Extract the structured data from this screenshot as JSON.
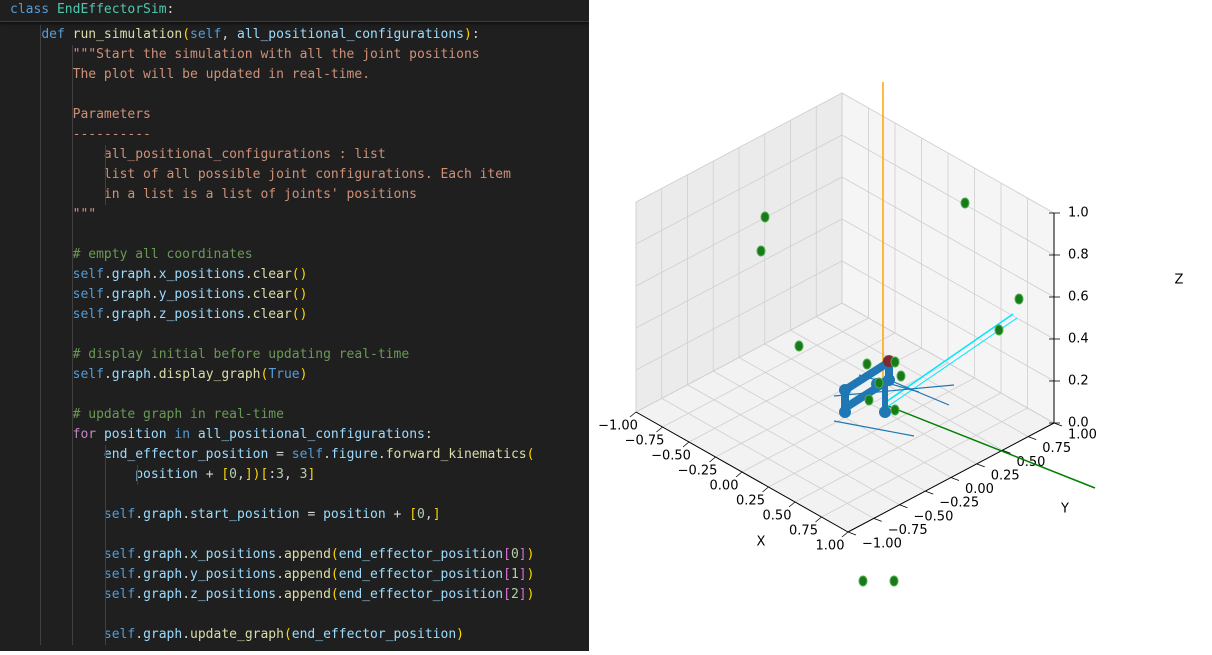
{
  "editor": {
    "sticky_class_line": "class EndEffectorSim:",
    "lines": [
      "    def run_simulation(self, all_positional_configurations):",
      "        \"\"\"Start the simulation with all the joint positions",
      "        The plot will be updated in real-time.",
      "",
      "        Parameters",
      "        ----------",
      "            all_positional_configurations : list",
      "            list of all possible joint configurations. Each item",
      "            in a list is a list of joints' positions",
      "        \"\"\"",
      "",
      "        # empty all coordinates",
      "        self.graph.x_positions.clear()",
      "        self.graph.y_positions.clear()",
      "        self.graph.z_positions.clear()",
      "",
      "        # display initial before updating real-time",
      "        self.graph.display_graph(True)",
      "",
      "        # update graph in real-time",
      "        for position in all_positional_configurations:",
      "            end_effector_position = self.figure.forward_kinematics(",
      "                position + [0,])[:3, 3]",
      "",
      "            self.graph.start_position = position + [0,]",
      "",
      "            self.graph.x_positions.append(end_effector_position[0])",
      "            self.graph.y_positions.append(end_effector_position[1])",
      "            self.graph.z_positions.append(end_effector_position[2])",
      "",
      "            self.graph.update_graph(end_effector_position)"
    ],
    "colors": {
      "background": "#1f1f1f",
      "keyword": "#569cd6",
      "function": "#dcdcaa",
      "string": "#ce9178",
      "comment": "#6a9955"
    }
  },
  "plot": {
    "x_axis": {
      "label": "X",
      "ticks": [
        "−1.00",
        "−0.75",
        "−0.50",
        "−0.25",
        "0.00",
        "0.25",
        "0.50",
        "0.75",
        "1.00"
      ]
    },
    "y_axis": {
      "label": "Y",
      "ticks": [
        "−1.00",
        "−0.75",
        "−0.50",
        "−0.25",
        "0.00",
        "0.25",
        "0.50",
        "0.75",
        "1.00"
      ]
    },
    "z_axis": {
      "label": "Z",
      "ticks": [
        "0.0",
        "0.2",
        "0.4",
        "0.6",
        "0.8",
        "1.0"
      ]
    },
    "colors": {
      "robot_arm": "#1f77b4",
      "z_line": "#ffa500",
      "y_line": "#008000",
      "x_line": "#00e5ff",
      "points": "#1a7a1a"
    }
  }
}
